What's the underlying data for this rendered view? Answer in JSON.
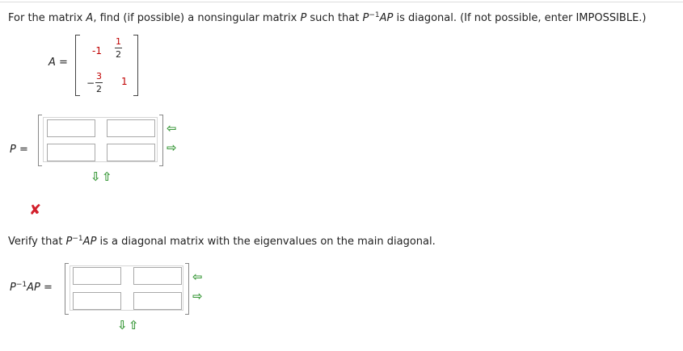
{
  "question": {
    "prefix": "For the matrix ",
    "var_a": "A",
    "middle": ", find (if possible) a nonsingular matrix ",
    "var_p": "P",
    "suchthat": " such that ",
    "p_inv": "P",
    "sup": "−1",
    "ap": "AP",
    "suffix": " is diagonal. (If not possible, enter IMPOSSIBLE.)"
  },
  "matrix_a": {
    "label": "A =",
    "a11": "-1",
    "a12_num": "1",
    "a12_den": "2",
    "a21_sign": "−",
    "a21_num": "3",
    "a21_den": "2",
    "a22": "1"
  },
  "p_matrix": {
    "label": "P =",
    "cells": [
      "",
      "",
      "",
      ""
    ]
  },
  "verify": {
    "text_prefix": "Verify that ",
    "p": "P",
    "sup": "−1",
    "ap": "AP",
    "text_suffix": " is a diagonal matrix with the eigenvalues on the main diagonal."
  },
  "d_matrix": {
    "label_p": "P",
    "label_sup": "−1",
    "label_ap": "AP =",
    "cells": [
      "",
      "",
      "",
      ""
    ]
  },
  "icons": {
    "wrong": "✘",
    "arrow_left": "⇦",
    "arrow_right": "⇨",
    "arrow_down": "⇩",
    "arrow_up": "⇧"
  },
  "colors": {
    "accent_red": "#c00000",
    "arrow_green": "#3c9a3c",
    "wrong_red": "#d21f2b"
  }
}
